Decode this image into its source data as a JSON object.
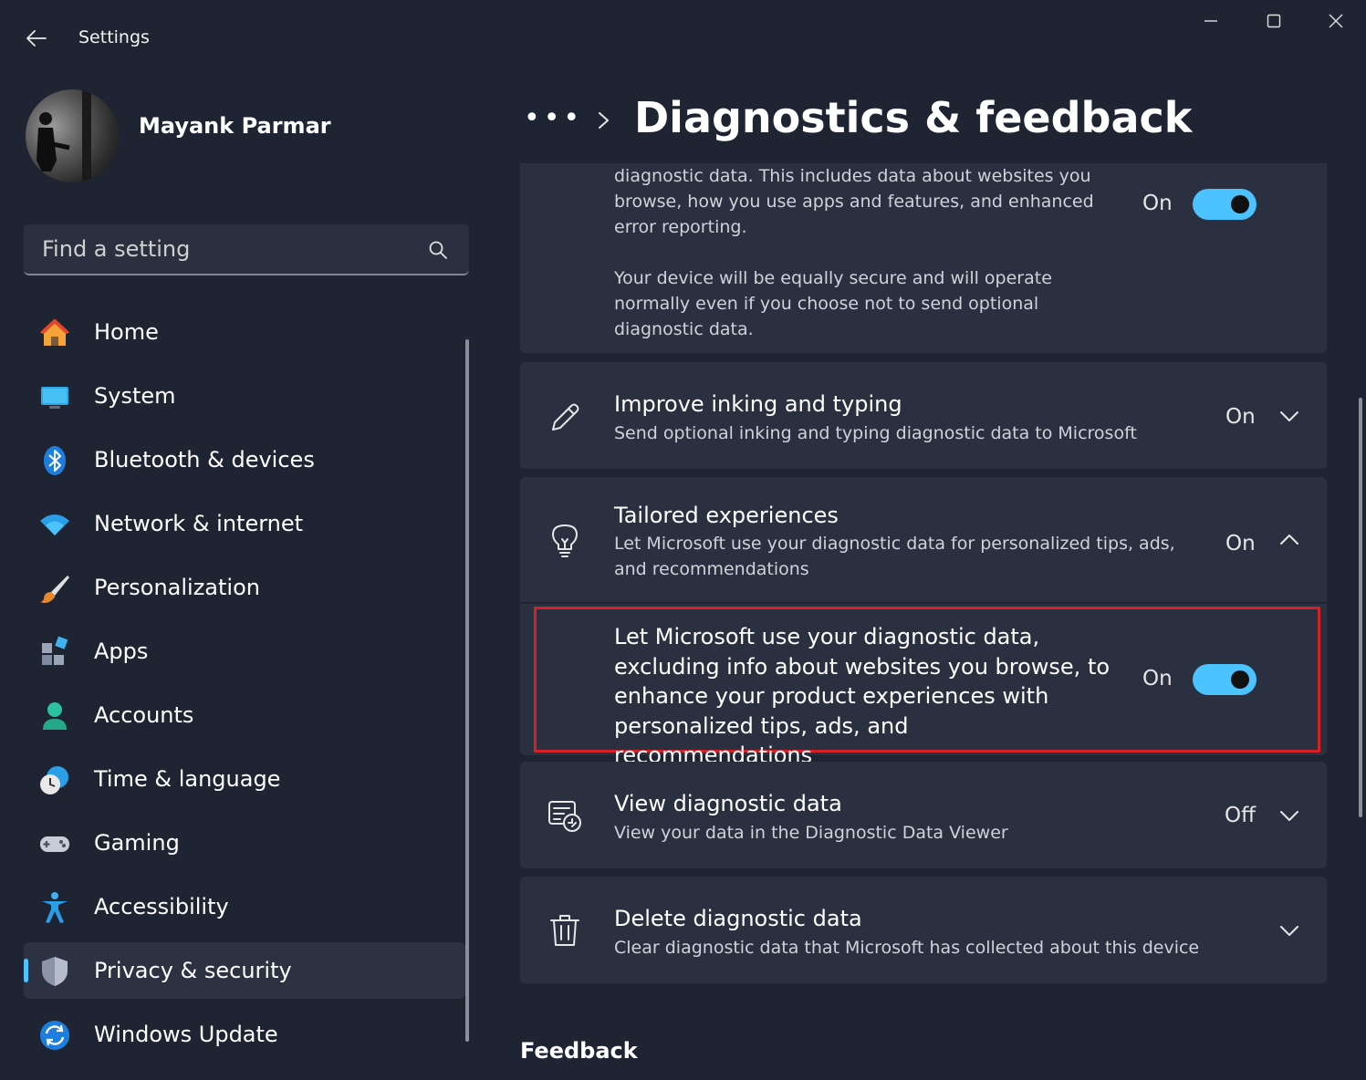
{
  "window": {
    "app_title": "Settings"
  },
  "profile": {
    "name": "Mayank Parmar"
  },
  "search": {
    "placeholder": "Find a setting"
  },
  "sidebar": {
    "items": [
      {
        "label": "Home",
        "icon": "home-icon"
      },
      {
        "label": "System",
        "icon": "system-icon"
      },
      {
        "label": "Bluetooth & devices",
        "icon": "bluetooth-icon"
      },
      {
        "label": "Network & internet",
        "icon": "wifi-icon"
      },
      {
        "label": "Personalization",
        "icon": "brush-icon"
      },
      {
        "label": "Apps",
        "icon": "apps-icon"
      },
      {
        "label": "Accounts",
        "icon": "person-icon"
      },
      {
        "label": "Time & language",
        "icon": "clock-globe-icon"
      },
      {
        "label": "Gaming",
        "icon": "gamepad-icon"
      },
      {
        "label": "Accessibility",
        "icon": "accessibility-icon"
      },
      {
        "label": "Privacy & security",
        "icon": "shield-icon",
        "selected": true
      },
      {
        "label": "Windows Update",
        "icon": "sync-icon"
      }
    ]
  },
  "header": {
    "breadcrumb_more": "•••",
    "title": "Diagnostics & feedback"
  },
  "optional_data": {
    "text_1": "diagnostic data. This includes data about websites you browse, how you use apps and features, and enhanced error reporting.",
    "text_2": "Your device will be equally secure and will operate normally even if you choose not to send optional diagnostic data.",
    "status": "On"
  },
  "inking": {
    "title": "Improve inking and typing",
    "subtitle": "Send optional inking and typing diagnostic data to Microsoft",
    "status": "On"
  },
  "tailored": {
    "title": "Tailored experiences",
    "subtitle": "Let Microsoft use your diagnostic data for personalized tips, ads, and recommendations",
    "status": "On",
    "option_text": "Let Microsoft use your diagnostic data, excluding info about websites you browse, to enhance your product experiences with personalized tips, ads, and recommendations",
    "option_status": "On"
  },
  "view_data": {
    "title": "View diagnostic data",
    "subtitle": "View your data in the Diagnostic Data Viewer",
    "status": "Off"
  },
  "delete_data": {
    "title": "Delete diagnostic data",
    "subtitle": "Clear diagnostic data that Microsoft has collected about this device"
  },
  "feedback": {
    "section_title": "Feedback"
  },
  "colors": {
    "accent": "#4cc2ff",
    "background": "#1f2433",
    "card": "#2b3040",
    "highlight": "#d42027"
  }
}
